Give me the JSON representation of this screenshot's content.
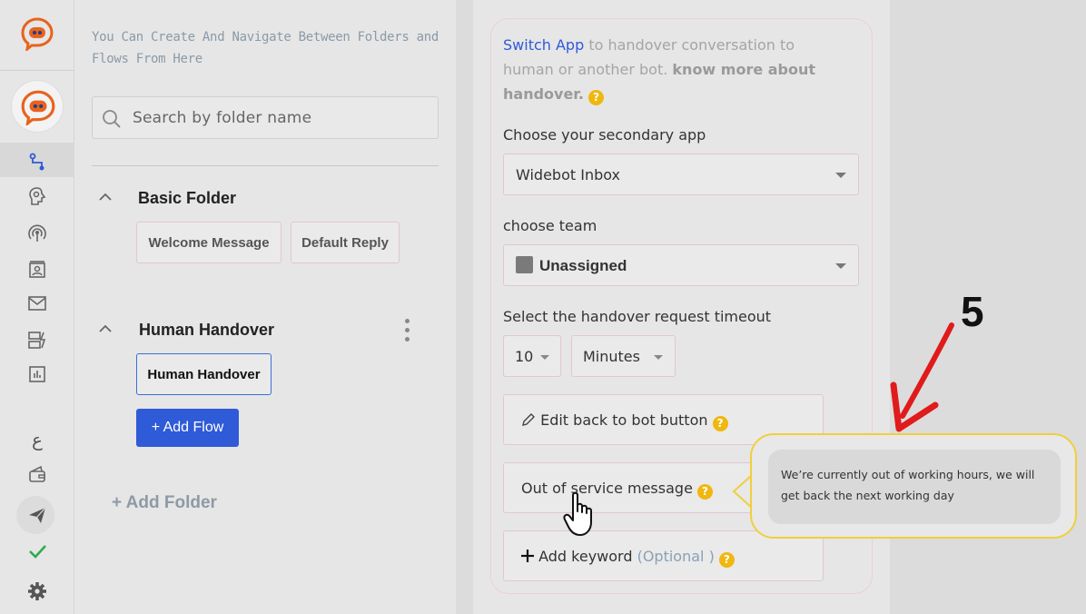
{
  "rail": {
    "items": [
      {
        "name": "flows-icon",
        "active": true
      },
      {
        "name": "ai-brain-icon"
      },
      {
        "name": "broadcast-icon"
      },
      {
        "name": "contacts-icon"
      },
      {
        "name": "mail-icon"
      },
      {
        "name": "integrations-icon"
      },
      {
        "name": "analytics-icon"
      },
      {
        "name": "language-icon",
        "glyph": "ع"
      },
      {
        "name": "wallet-icon"
      },
      {
        "name": "publish-icon"
      },
      {
        "name": "check-icon"
      },
      {
        "name": "settings-icon"
      }
    ],
    "brand_color": "#e8631c",
    "accent": "#2f5ad8"
  },
  "folders_panel": {
    "hint": "You Can Create And Navigate Between Folders and Flows From Here",
    "search": {
      "placeholder": "Search by folder name"
    },
    "folders": [
      {
        "name": "Basic Folder",
        "flows": [
          "Welcome Message",
          "Default Reply"
        ]
      },
      {
        "name": "Human Handover",
        "flows": [
          "Human Handover"
        ],
        "selected_flow": "Human Handover"
      }
    ],
    "add_flow_label": "+ Add Flow",
    "add_folder_label": "+ Add Folder"
  },
  "config_panel": {
    "intro": {
      "link": "Switch App",
      "text": " to handover conversation to human or another bot. ",
      "bold": "know more about handover."
    },
    "secondary_app": {
      "label": "Choose your secondary app",
      "value": "Widebot Inbox"
    },
    "team": {
      "label": "choose team",
      "value": "Unassigned"
    },
    "timeout": {
      "label": "Select the handover request timeout",
      "amount": "10",
      "unit": "Minutes"
    },
    "edit_back_button": "Edit back to bot button",
    "out_of_service": "Out of service message",
    "add_keyword": {
      "label": "Add keyword",
      "optional": "(Optional )"
    }
  },
  "tooltip": {
    "message": "We’re currently out of working hours, we will get back the next working day"
  },
  "annotation": {
    "step": "5",
    "color": "#e01b1b"
  }
}
